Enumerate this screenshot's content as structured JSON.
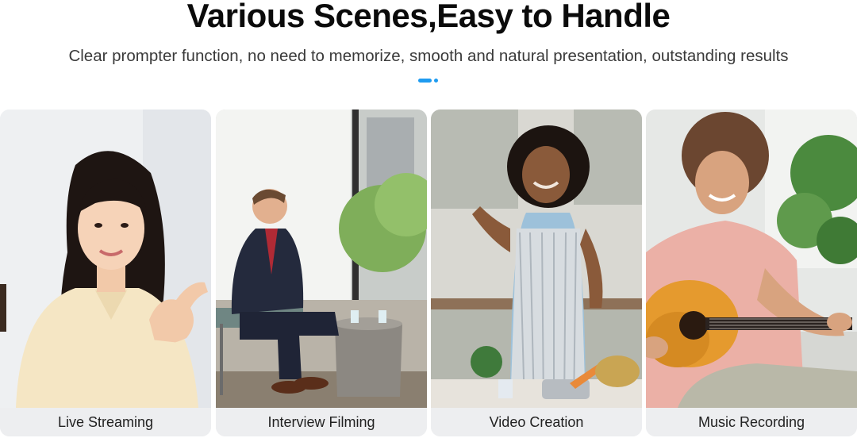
{
  "header": {
    "title": "Various Scenes,Easy to Handle",
    "subtitle": "Clear prompter function, no need to memorize, smooth and natural presentation, outstanding results"
  },
  "accent_color": "#1e9bf0",
  "cards": [
    {
      "label": "Live Streaming",
      "image": "woman-live-streaming-photo"
    },
    {
      "label": "Interview Filming",
      "image": "man-seated-interview-photo"
    },
    {
      "label": "Video Creation",
      "image": "woman-cooking-video-photo"
    },
    {
      "label": "Music Recording",
      "image": "man-playing-guitar-photo"
    }
  ]
}
